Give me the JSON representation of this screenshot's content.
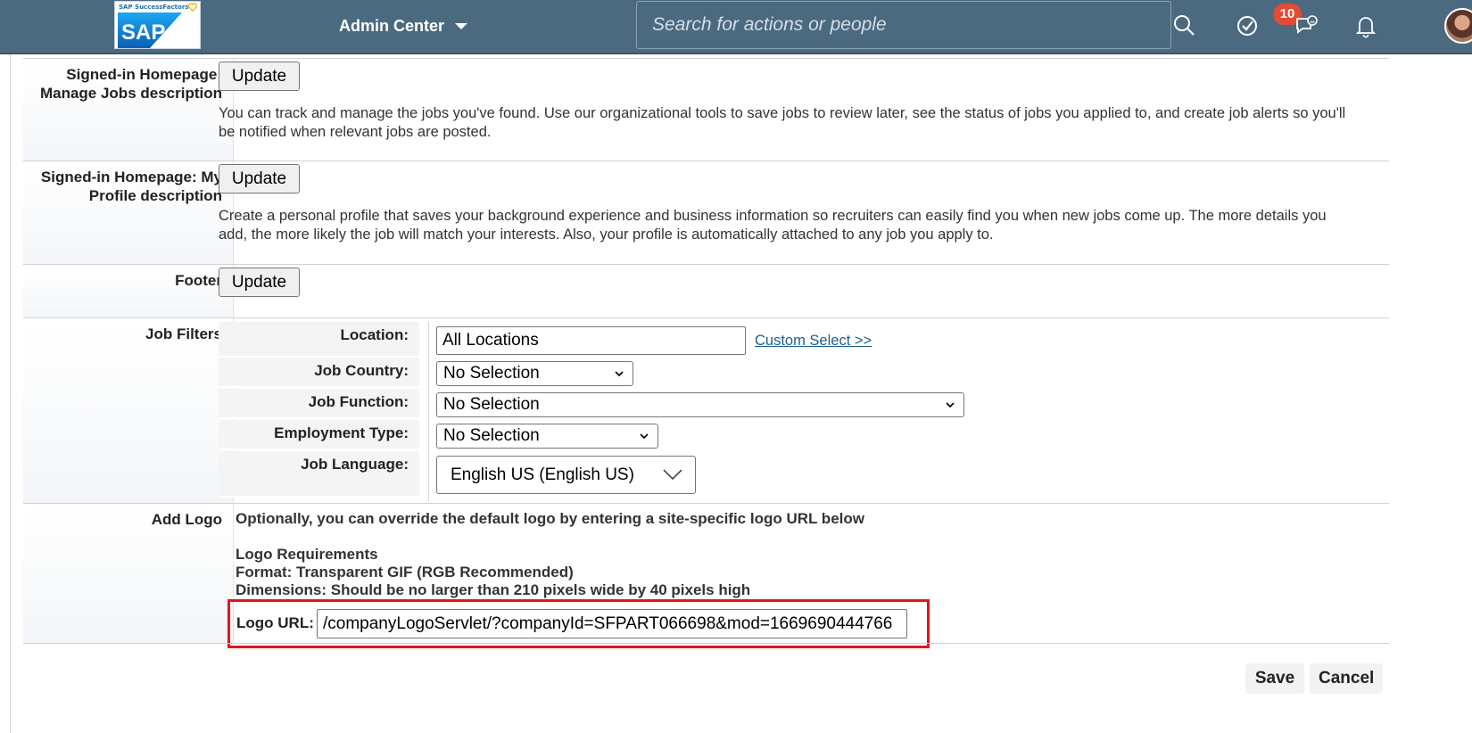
{
  "header": {
    "logo_tagline": "SAP SuccessFactors",
    "logo_text": "SAP",
    "menu_label": "Admin Center",
    "search_placeholder": "Search for actions or people",
    "notification_count": "10"
  },
  "rows": {
    "manage_jobs": {
      "label": "Signed-in Homepage: Manage Jobs description",
      "button": "Update",
      "description": "You can track and manage the jobs you've found. Use our organizational tools to save jobs to review later, see the status of jobs you applied to, and create job alerts so you'll be notified when relevant jobs are posted."
    },
    "my_profile": {
      "label": "Signed-in Homepage: My Profile description",
      "button": "Update",
      "description": "Create a personal profile that saves your background experience and business information so recruiters can easily find you when new jobs come up. The more details you add, the more likely the job will match your interests. Also, your profile is automatically attached to any job you apply to."
    },
    "footer": {
      "label": "Footer",
      "button": "Update"
    },
    "job_filters": {
      "label": "Job Filters",
      "location_label": "Location:",
      "location_value": "All Locations",
      "custom_select": "Custom Select >>",
      "country_label": "Job Country:",
      "country_value": "No Selection",
      "function_label": "Job Function:",
      "function_value": "No Selection",
      "employment_label": "Employment Type:",
      "employment_value": "No Selection",
      "language_label": "Job Language:",
      "language_value": "English US (English US)"
    },
    "add_logo": {
      "label": "Add Logo",
      "intro": "Optionally, you can override the default logo by entering a site-specific logo URL below",
      "req_title": "Logo Requirements",
      "req_format": "Format: Transparent GIF (RGB Recommended)",
      "req_dimensions": "Dimensions: Should be no larger than 210 pixels wide by 40 pixels high",
      "url_label": "Logo URL:",
      "url_value": "/companyLogoServlet/?companyId=SFPART066698&mod=1669690444766"
    }
  },
  "actions": {
    "save": "Save",
    "cancel": "Cancel"
  },
  "colors": {
    "shell": "#4b6a80",
    "highlight": "#e3151a",
    "badge": "#e34b36",
    "link": "#1a5f8f"
  }
}
